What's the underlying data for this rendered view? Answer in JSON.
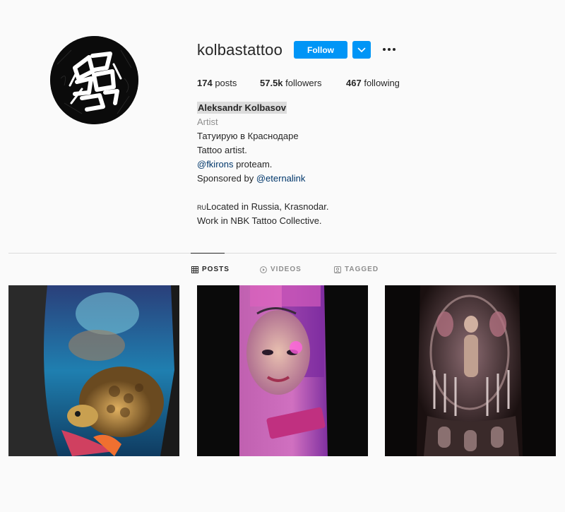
{
  "profile": {
    "username": "kolbastattoo",
    "follow_label": "Follow",
    "icons": [
      "chevron-down-icon",
      "more-options-icon"
    ]
  },
  "stats": {
    "posts_count": "174",
    "posts_label": "posts",
    "followers_count": "57.5k",
    "followers_label": "followers",
    "following_count": "467",
    "following_label": "following"
  },
  "bio": {
    "full_name": "Aleksandr Kolbasov",
    "category": "Artist",
    "line1": "Татуирую в Краснодаре",
    "line2": "Tattoo artist.",
    "mention1": "@fkirons",
    "line3_rest": " proteam.",
    "line4_prefix": "Sponsored by ",
    "mention2": "@eternalink",
    "ru_prefix": "RU",
    "line5": "Located in Russia, Krasnodar.",
    "line6": "Work in NBK Tattoo Collective."
  },
  "tabs": [
    {
      "label": "POSTS",
      "icon": "grid-icon",
      "active": true
    },
    {
      "label": "VIDEOS",
      "icon": "play-icon",
      "active": false
    },
    {
      "label": "TAGGED",
      "icon": "tag-icon",
      "active": false
    }
  ],
  "colors": {
    "accent": "#0095f6",
    "text": "#262626",
    "muted": "#8e8e8e",
    "link": "#00376b",
    "background": "#fafafa"
  }
}
